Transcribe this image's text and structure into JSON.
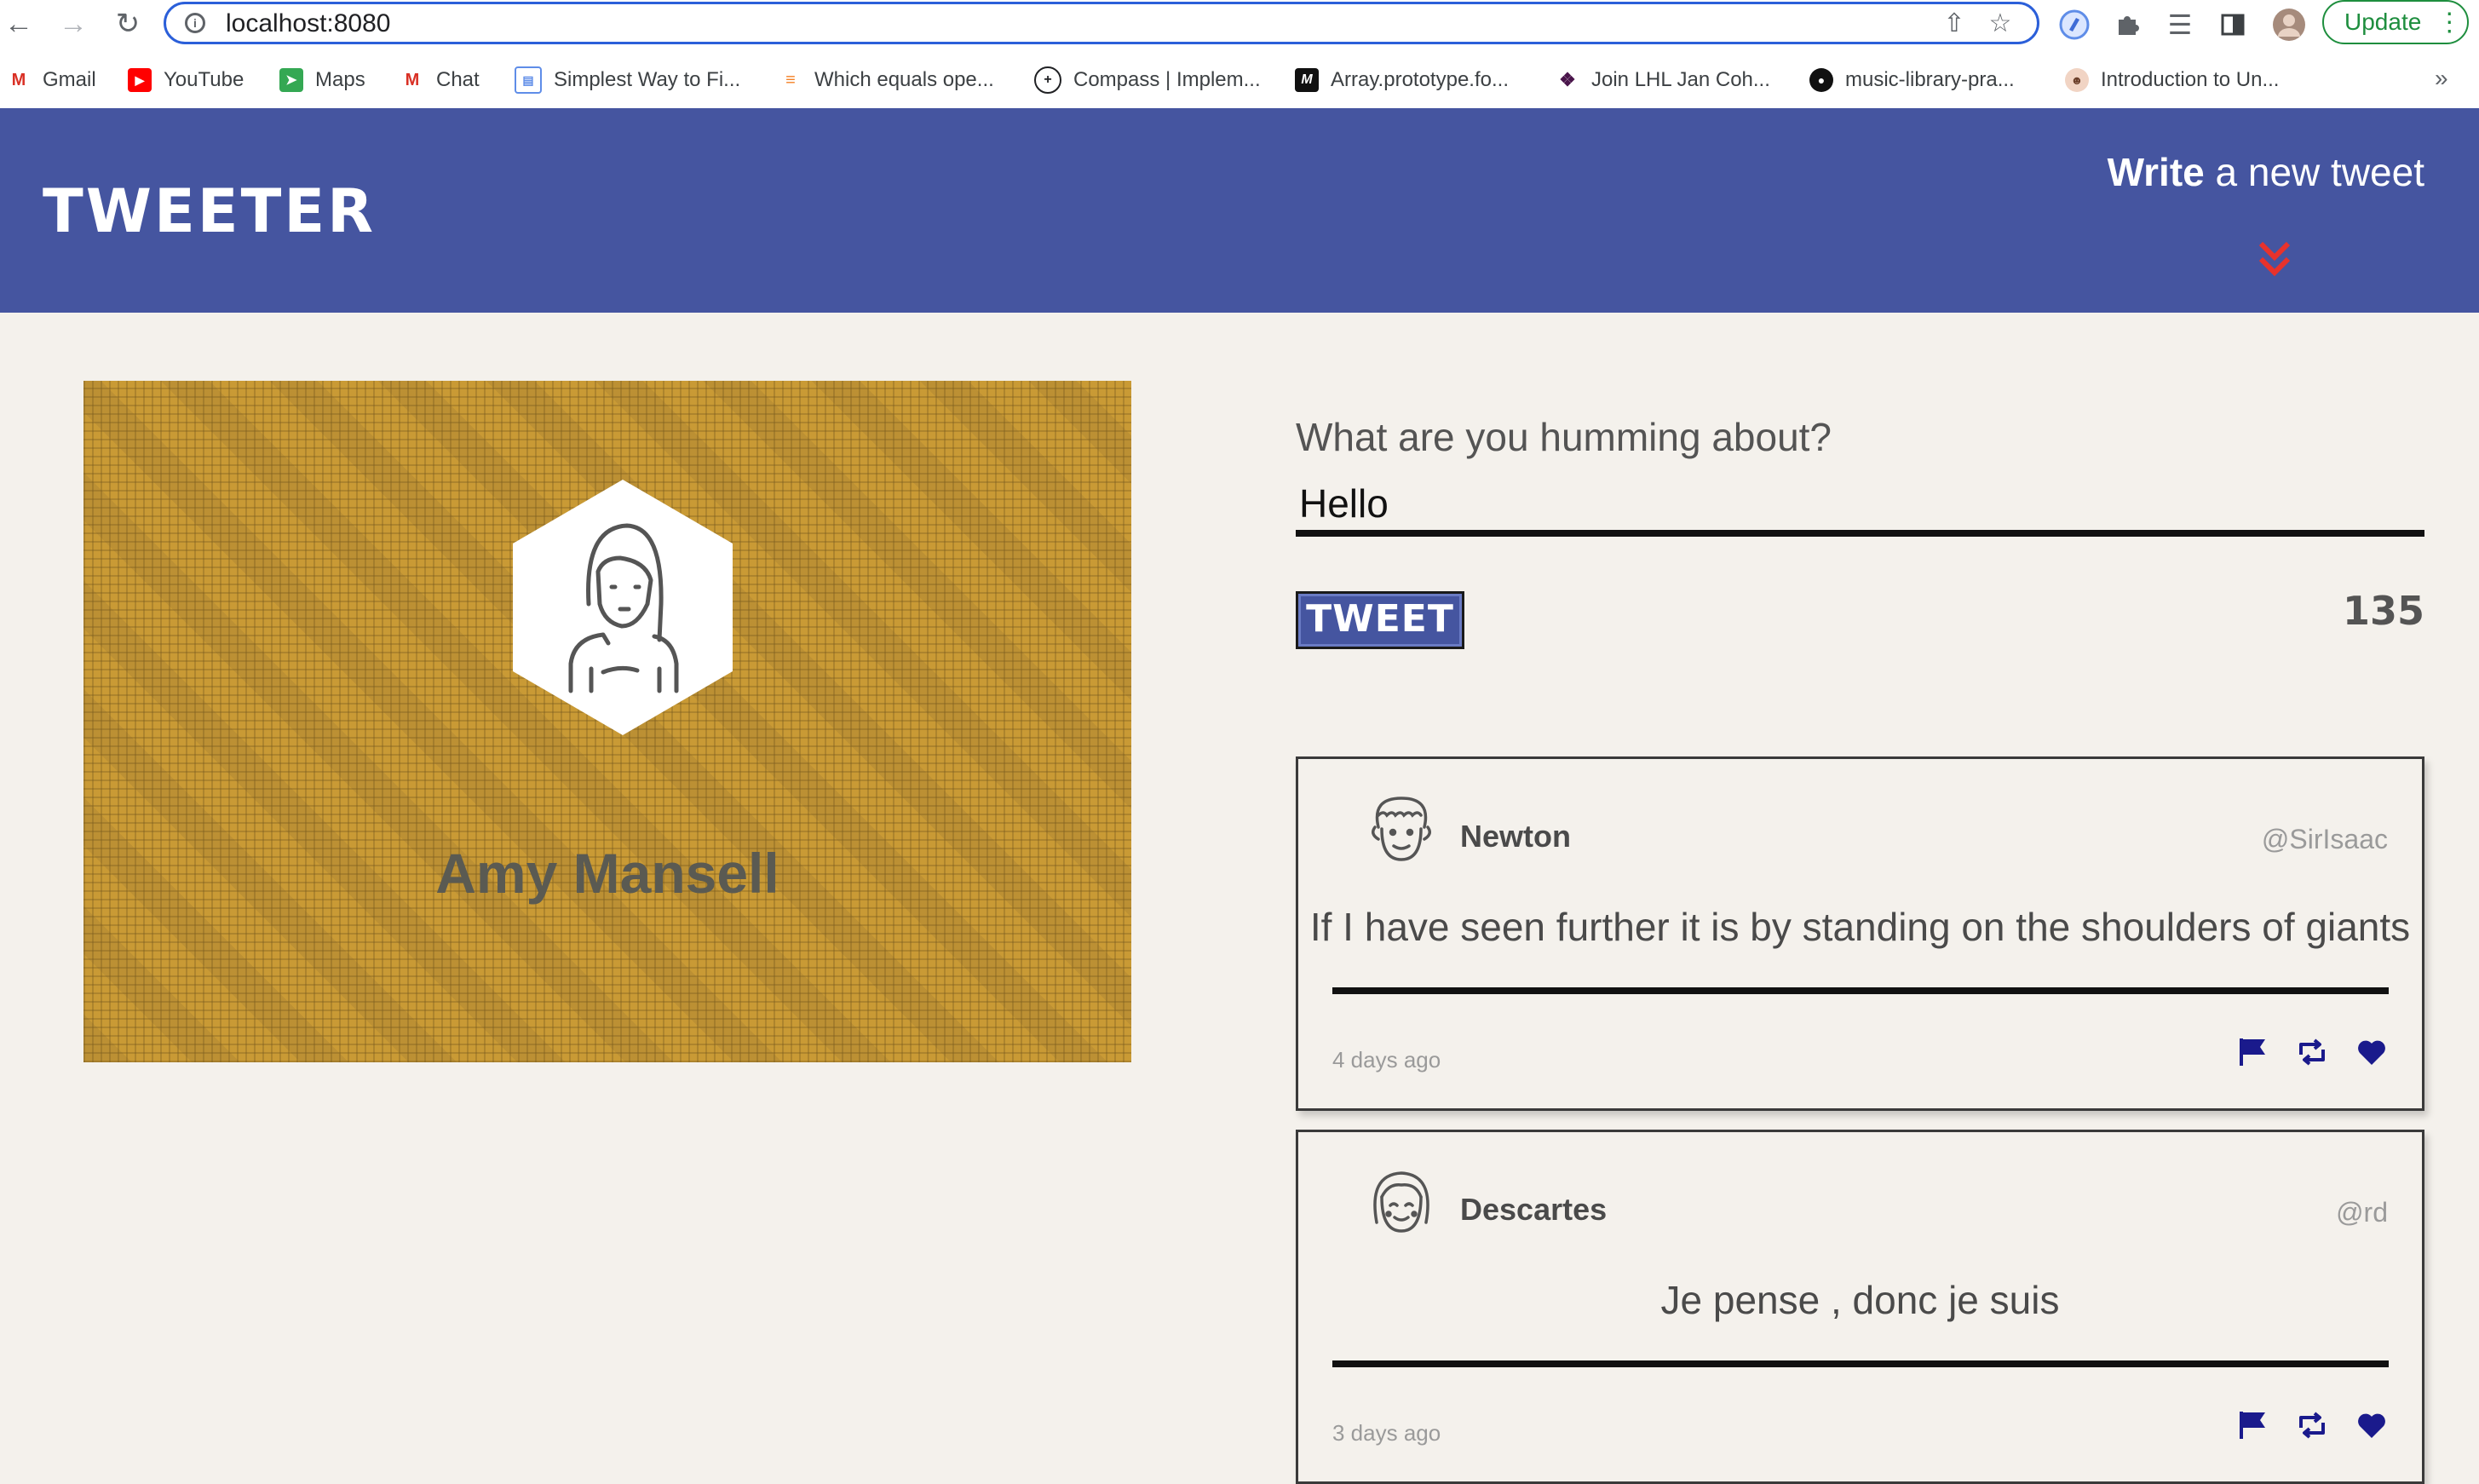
{
  "browser": {
    "url": "localhost:8080",
    "update_label": "Update",
    "bookmarks": [
      {
        "label": "Gmail",
        "icon": "gmail-icon"
      },
      {
        "label": "YouTube",
        "icon": "youtube-icon"
      },
      {
        "label": "Maps",
        "icon": "maps-icon"
      },
      {
        "label": "Chat",
        "icon": "chat-icon"
      },
      {
        "label": "Simplest Way to Fi...",
        "icon": "page-icon"
      },
      {
        "label": "Which equals ope...",
        "icon": "stackoverflow-icon"
      },
      {
        "label": "Compass | Implem...",
        "icon": "compass-icon"
      },
      {
        "label": "Array.prototype.fo...",
        "icon": "mdn-icon"
      },
      {
        "label": "Join LHL Jan Coh...",
        "icon": "slack-icon"
      },
      {
        "label": "music-library-pra...",
        "icon": "github-icon"
      },
      {
        "label": "Introduction to Un...",
        "icon": "avatar-icon"
      }
    ],
    "more_label": "»"
  },
  "nav": {
    "brand": "TWEETER",
    "write_bold": "Write",
    "write_rest": " a new tweet"
  },
  "profile": {
    "name": "Amy Mansell"
  },
  "composer": {
    "label": "What are you humming about?",
    "value": "Hello",
    "button": "TWEET",
    "counter": "135"
  },
  "tweets": [
    {
      "name": "Newton",
      "handle": "@SirIsaac",
      "text": "If I have seen further it is by standing on the shoulders of giants",
      "time": "4 days ago"
    },
    {
      "name": "Descartes",
      "handle": "@rd",
      "text": "Je pense , donc je suis",
      "time": "3 days ago"
    }
  ],
  "colors": {
    "nav_bg": "#4555a0",
    "accent_red": "#e8322c",
    "action_icons": "#1a1a8c",
    "profile_bg": "#c99a35",
    "page_bg": "#f4f1ec"
  }
}
